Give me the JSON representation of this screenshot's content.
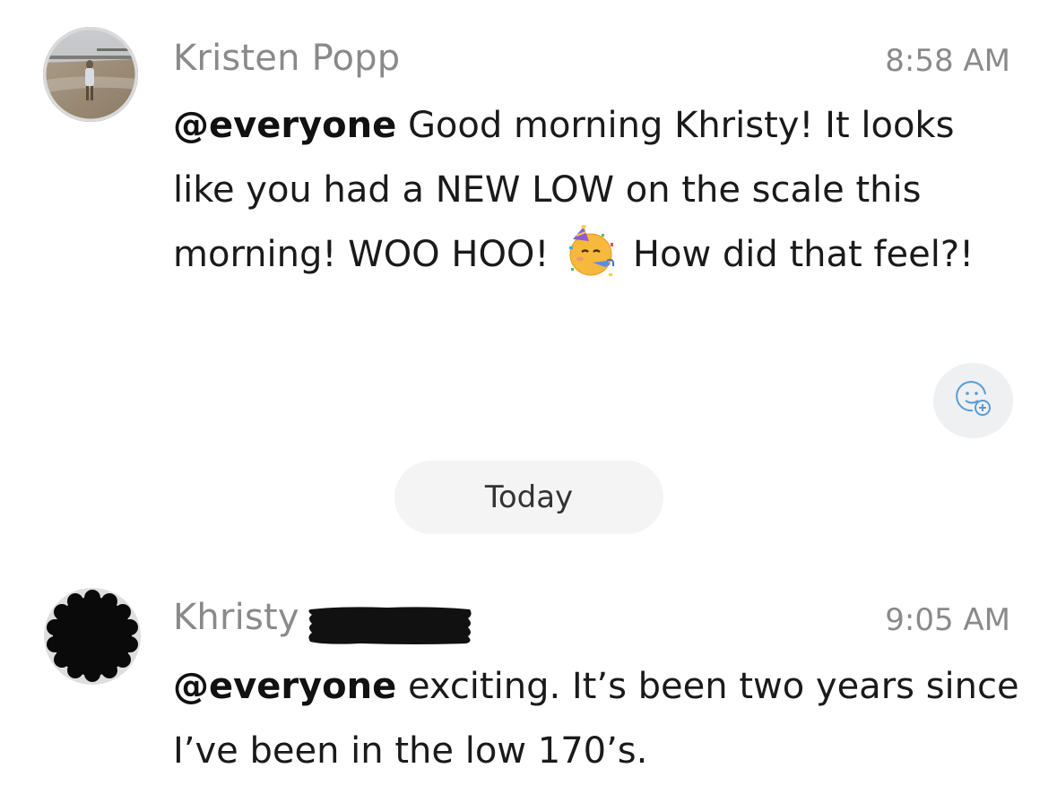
{
  "messages": [
    {
      "sender": "Kristen Popp",
      "time": "8:58 AM",
      "mention": "@everyone",
      "text_part1": "Good morning Khristy! It looks like you had a NEW LOW on the scale this morning! WOO HOO!",
      "emoji": "partying-face-emoji",
      "text_part2": "How did that feel?!"
    },
    {
      "sender": "Khristy",
      "sender_redacted": true,
      "time": "9:05 AM",
      "mention": "@everyone",
      "text": "exciting. It’s been two years since I’ve been in the low 170’s."
    }
  ],
  "date_divider": "Today",
  "icons": {
    "reaction": "add-reaction-icon"
  },
  "colors": {
    "meta_text": "#8a8a8a",
    "reaction_icon": "#5b9bd5",
    "pill_bg": "#f4f4f4"
  }
}
